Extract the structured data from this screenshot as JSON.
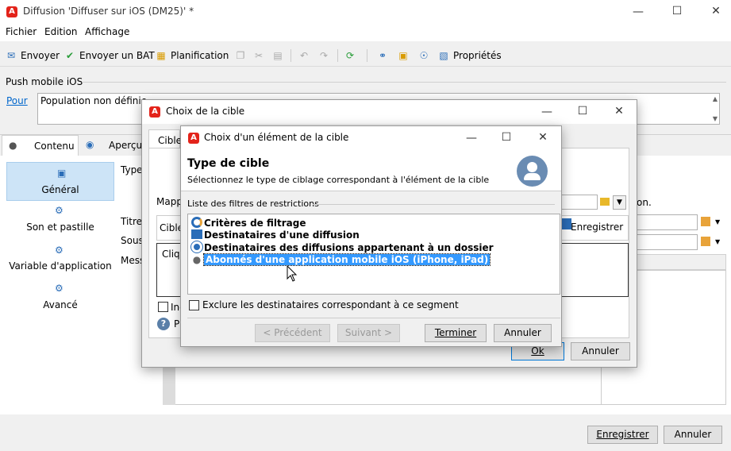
{
  "main": {
    "title": "Diffusion 'Diffuser sur iOS (DM25)' *",
    "menu": [
      "Fichier",
      "Edition",
      "Affichage"
    ],
    "toolbar": {
      "send": "Envoyer",
      "send_bat": "Envoyer un BAT",
      "schedule": "Planification",
      "properties": "Propriétés"
    },
    "push_label": "Push mobile iOS",
    "pour_link": "Pour",
    "population": "Population non définie",
    "tabs": {
      "content": "Contenu",
      "preview": "Aperçu"
    },
    "sidebar": [
      "Général",
      "Son et pastille",
      "Variable d'application",
      "Avancé"
    ],
    "type_label": "Type",
    "map_label": "Mapp",
    "titre_label": "Titre",
    "sous_label": "Sous",
    "mess_label": "Mess",
    "on_text": "on.",
    "save_btn": "Enregistrer",
    "cancel_btn": "Annuler"
  },
  "dlg1": {
    "title": "Choix de la cible",
    "tab": "Cible",
    "cible_label": "Cible",
    "cliq_text": "Cliq",
    "inc_label": "Inc",
    "p_label": "P",
    "save_btn": "Enregistrer",
    "ok_btn": "Ok",
    "cancel_btn": "Annuler"
  },
  "dlg2": {
    "title": "Choix d'un élément de la cible",
    "heading": "Type de cible",
    "subheading": "Sélectionnez le type de ciblage correspondant à l'élément de la cible",
    "list_label": "Liste des filtres de restrictions",
    "items": [
      {
        "label": "Critères de filtrage",
        "icon": "filter-icon"
      },
      {
        "label": "Destinataires d'une diffusion",
        "icon": "envelope-icon"
      },
      {
        "label": "Destinataires des diffusions appartenant à un dossier",
        "icon": "folder-delivery-icon"
      },
      {
        "label": "Abonnés d'une application mobile iOS (iPhone, iPad)",
        "icon": "apple-icon"
      }
    ],
    "exclude_label": "Exclure les destinataires correspondant à ce segment",
    "prev_btn": "< Précédent",
    "next_btn": "Suivant >",
    "finish_btn": "Terminer",
    "cancel_btn": "Annuler"
  },
  "colors": {
    "accent": "#0078d7",
    "selection": "#3399ff",
    "logo": "#e3231a"
  }
}
